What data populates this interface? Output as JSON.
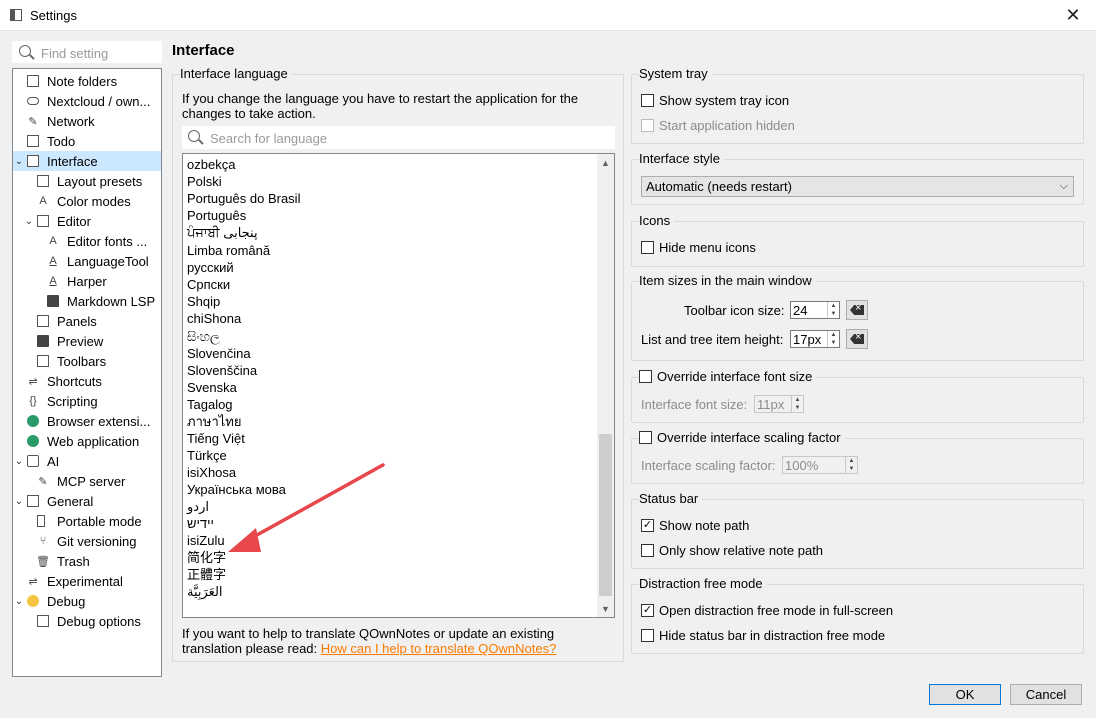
{
  "window": {
    "title": "Settings",
    "close": "✕"
  },
  "sidebar": {
    "search_placeholder": "Find setting",
    "items": [
      {
        "label": "Note folders"
      },
      {
        "label": "Nextcloud / own..."
      },
      {
        "label": "Network"
      },
      {
        "label": "Todo"
      },
      {
        "label": "Interface"
      },
      {
        "label": "Layout presets"
      },
      {
        "label": "Color modes"
      },
      {
        "label": "Editor"
      },
      {
        "label": "Editor fonts ..."
      },
      {
        "label": "LanguageTool"
      },
      {
        "label": "Harper"
      },
      {
        "label": "Markdown LSP"
      },
      {
        "label": "Panels"
      },
      {
        "label": "Preview"
      },
      {
        "label": "Toolbars"
      },
      {
        "label": "Shortcuts"
      },
      {
        "label": "Scripting"
      },
      {
        "label": "Browser extensi..."
      },
      {
        "label": "Web application"
      },
      {
        "label": "AI"
      },
      {
        "label": "MCP server"
      },
      {
        "label": "General"
      },
      {
        "label": "Portable mode"
      },
      {
        "label": "Git versioning"
      },
      {
        "label": "Trash"
      },
      {
        "label": "Experimental"
      },
      {
        "label": "Debug"
      },
      {
        "label": "Debug options"
      }
    ]
  },
  "page": {
    "title": "Interface"
  },
  "interface_language": {
    "group_title": "Interface language",
    "description": "If you change the language you have to restart the application for the changes to take action.",
    "search_placeholder": "Search for language",
    "languages": [
      "ozbekça",
      "Polski",
      "Português do Brasil",
      "Português",
      "ਪੰਜਾਬੀ پنجابی",
      "Limba română",
      "русский",
      "Српски",
      "Shqip",
      "chiShona",
      "සිංහල",
      "Slovenčina",
      "Slovenščina",
      "Svenska",
      "Tagalog",
      "ภาษาไทย",
      "Tiếng Việt",
      "Türkçe",
      "isiXhosa",
      "Українська мова",
      "اردو",
      "יידיש",
      "isiZulu",
      "简化字",
      "正體字",
      "العَرَبِيَّة"
    ],
    "help_text": "If you want to help to translate QOwnNotes or update an existing translation please read: ",
    "help_link": "How can I help to translate QOwnNotes?",
    "scroll_up": "▲",
    "scroll_down": "▼"
  },
  "system_tray": {
    "group_title": "System tray",
    "show_icon_label": "Show system tray icon",
    "show_icon_checked": false,
    "start_hidden_label": "Start application hidden",
    "start_hidden_checked": false
  },
  "interface_style": {
    "group_title": "Interface style",
    "selected": "Automatic (needs restart)",
    "chevron": "⌵"
  },
  "icons": {
    "group_title": "Icons",
    "hide_menu_icons_label": "Hide menu icons",
    "hide_menu_icons_checked": false
  },
  "item_sizes": {
    "group_title": "Item sizes in the main window",
    "toolbar_icon_label": "Toolbar icon size:",
    "toolbar_icon_value": "24",
    "list_height_label": "List and tree item height:",
    "list_height_value": "17px"
  },
  "font_size": {
    "override_label": "Override interface font size",
    "override_checked": false,
    "field_label": "Interface font size:",
    "field_value": "11px"
  },
  "scaling": {
    "override_label": "Override interface scaling factor",
    "override_checked": false,
    "field_label": "Interface scaling factor:",
    "field_value": "100%"
  },
  "status_bar": {
    "group_title": "Status bar",
    "show_note_path_label": "Show note path",
    "show_note_path_checked": true,
    "relative_path_label": "Only show relative note path",
    "relative_path_checked": false
  },
  "distraction_free": {
    "group_title": "Distraction free mode",
    "fullscreen_label": "Open distraction free mode in full-screen",
    "fullscreen_checked": true,
    "hide_status_label": "Hide status bar in distraction free mode",
    "hide_status_checked": false
  },
  "buttons": {
    "ok": "OK",
    "cancel": "Cancel"
  },
  "check_mark": "✓",
  "spin_up": "▲",
  "spin_down": "▼",
  "colors": {
    "selection": "#cce8ff",
    "link": "#ff7a00",
    "annotation_arrow": "#e8474c"
  }
}
